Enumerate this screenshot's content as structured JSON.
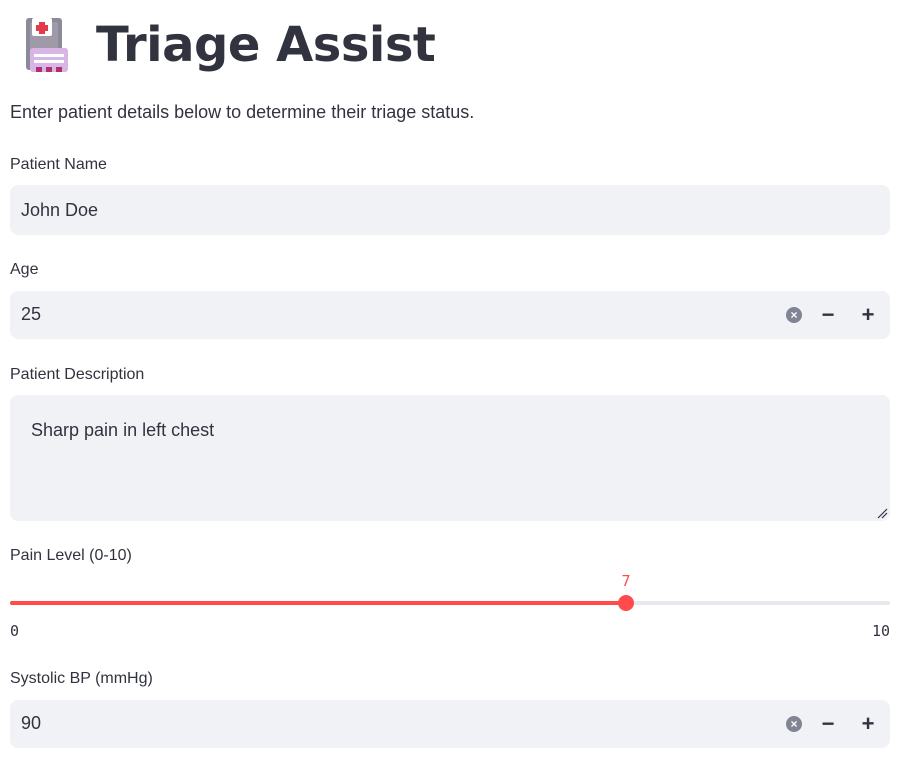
{
  "app": {
    "title": "Triage Assist",
    "subtitle": "Enter patient details below to determine their triage status."
  },
  "icons": {
    "logo": "medical-clipboard-icon",
    "clear": "clear-icon",
    "minus": "minus-icon",
    "plus": "plus-icon"
  },
  "colors": {
    "accent": "#ff4b4b",
    "field_bg": "#f0f2f6",
    "text": "#31333f"
  },
  "form": {
    "name": {
      "label": "Patient Name",
      "value": "John Doe"
    },
    "age": {
      "label": "Age",
      "value": "25",
      "clear": "×",
      "minus": "−",
      "plus": "+"
    },
    "description": {
      "label": "Patient Description",
      "value": "Sharp pain in left chest"
    },
    "pain": {
      "label": "Pain Level (0-10)",
      "value": 7,
      "min": 0,
      "max": 10,
      "value_label": "7",
      "min_label": "0",
      "max_label": "10"
    },
    "systolic": {
      "label": "Systolic BP (mmHg)",
      "value": "90",
      "clear": "×",
      "minus": "−",
      "plus": "+"
    }
  }
}
